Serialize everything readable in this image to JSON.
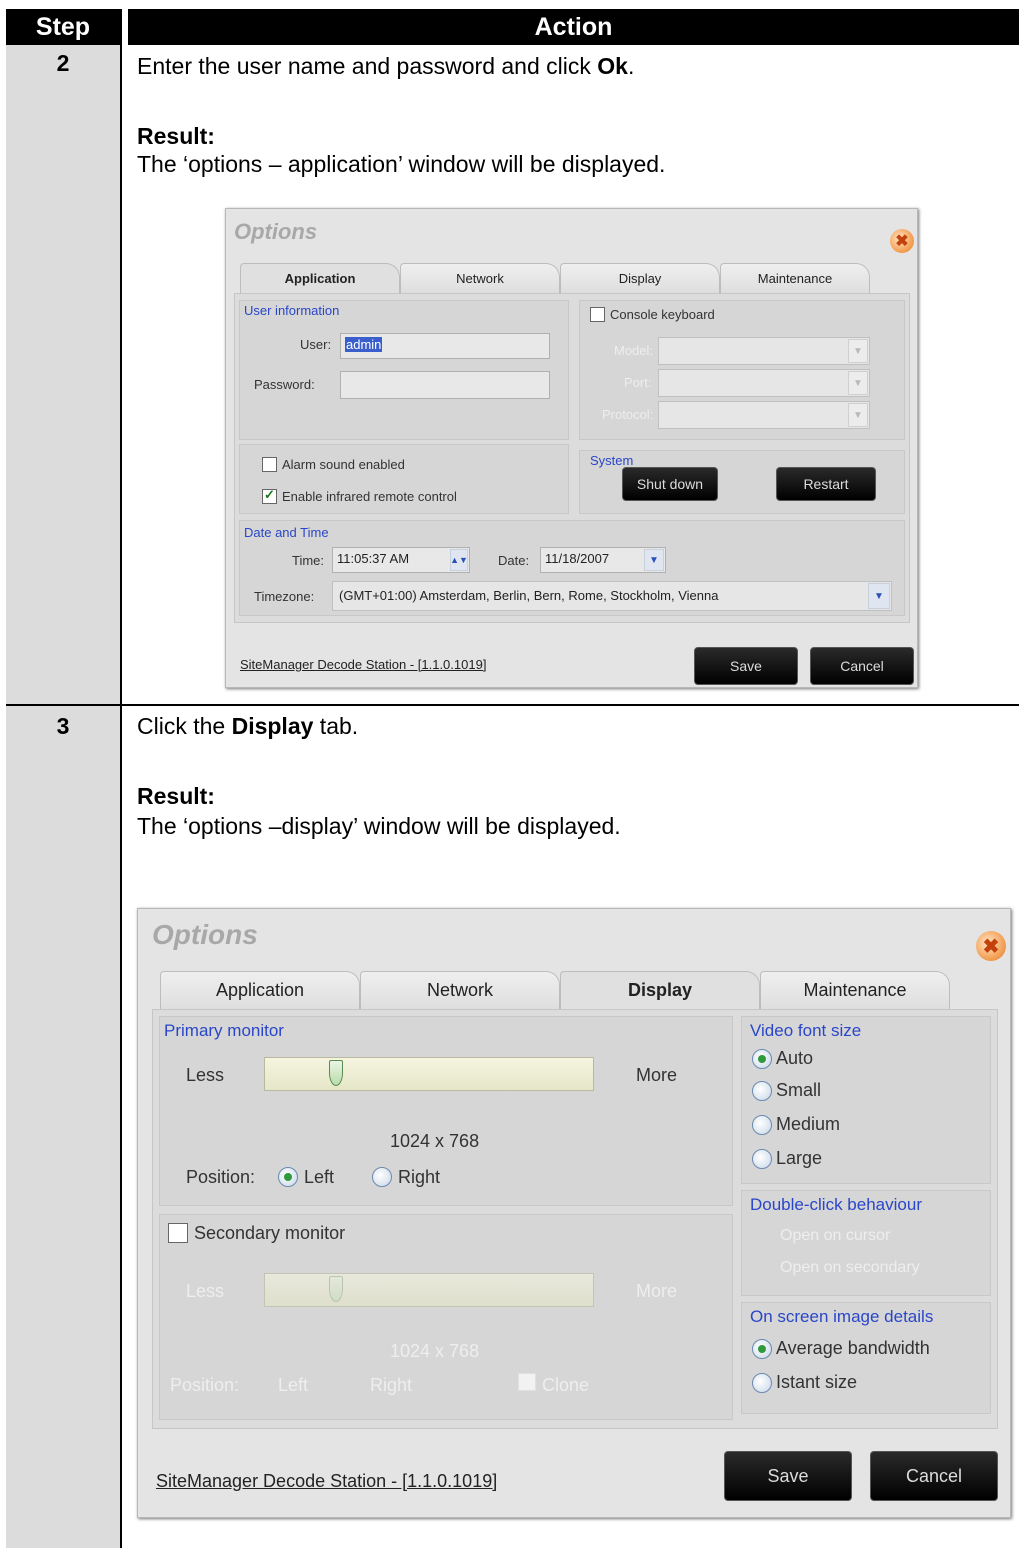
{
  "table": {
    "header_step": "Step",
    "header_action": "Action"
  },
  "steps": [
    {
      "number": "2",
      "instruction_pre": "Enter the user name and password and click ",
      "instruction_bold": "Ok",
      "instruction_post": ".",
      "result_label": "Result:",
      "result_text": "The ‘options – application’ window will be displayed."
    },
    {
      "number": "3",
      "instruction_pre": "Click the ",
      "instruction_bold": "Display",
      "instruction_post": " tab.",
      "result_label": "Result:",
      "result_text": "The ‘options –display’ window will be displayed."
    }
  ],
  "dialog1": {
    "title": "Options",
    "close_icon": "close-icon",
    "tabs": [
      "Application",
      "Network",
      "Display",
      "Maintenance"
    ],
    "active_tab": "Application",
    "user_info_label": "User information",
    "user_label": "User:",
    "user_value": "admin",
    "password_label": "Password:",
    "password_value": "",
    "console_keyboard_label": "Console keyboard",
    "console_keyboard_checked": false,
    "console_disabled_labels": [
      "Model:",
      "Port:",
      "Protocol:"
    ],
    "alarm_sound_label": "Alarm sound enabled",
    "alarm_sound_checked": false,
    "infrared_label": "Enable infrared remote control",
    "infrared_checked": true,
    "system_label": "System",
    "shutdown_label": "Shut down",
    "restart_label": "Restart",
    "date_time_label": "Date and Time",
    "time_label": "Time:",
    "time_value": "11:05:37 AM",
    "date_label": "Date:",
    "date_value": "11/18/2007",
    "timezone_label": "Timezone:",
    "timezone_value": "(GMT+01:00) Amsterdam, Berlin, Bern, Rome, Stockholm, Vienna",
    "footer_link": "SiteManager Decode Station - [1.1.0.1019]",
    "save_label": "Save",
    "cancel_label": "Cancel"
  },
  "dialog2": {
    "title": "Options",
    "close_icon": "close-icon",
    "tabs": [
      "Application",
      "Network",
      "Display",
      "Maintenance"
    ],
    "active_tab": "Display",
    "primary_monitor_label": "Primary monitor",
    "less_label": "Less",
    "more_label": "More",
    "primary_resolution": "1024 x 768",
    "position_label": "Position:",
    "left_label": "Left",
    "right_label": "Right",
    "primary_position": "Left",
    "secondary_monitor_label": "Secondary monitor",
    "secondary_monitor_checked": false,
    "secondary_less_label": "Less",
    "secondary_more_label": "More",
    "secondary_resolution": "1024 x 768",
    "secondary_position_label": "Position:",
    "secondary_left_label": "Left",
    "secondary_right_label": "Right",
    "secondary_clone_label": "Clone",
    "video_font_size_label": "Video font size",
    "font_options": [
      "Auto",
      "Small",
      "Medium",
      "Large"
    ],
    "font_selected": "Auto",
    "double_click_label": "Double-click behaviour",
    "double_click_options": [
      "Open on cursor",
      "Open on secondary"
    ],
    "on_screen_label": "On screen image details",
    "on_screen_options": [
      "Average bandwidth",
      "Istant size"
    ],
    "on_screen_selected": "Average bandwidth",
    "footer_link": "SiteManager Decode Station - [1.1.0.1019]",
    "save_label": "Save",
    "cancel_label": "Cancel"
  }
}
